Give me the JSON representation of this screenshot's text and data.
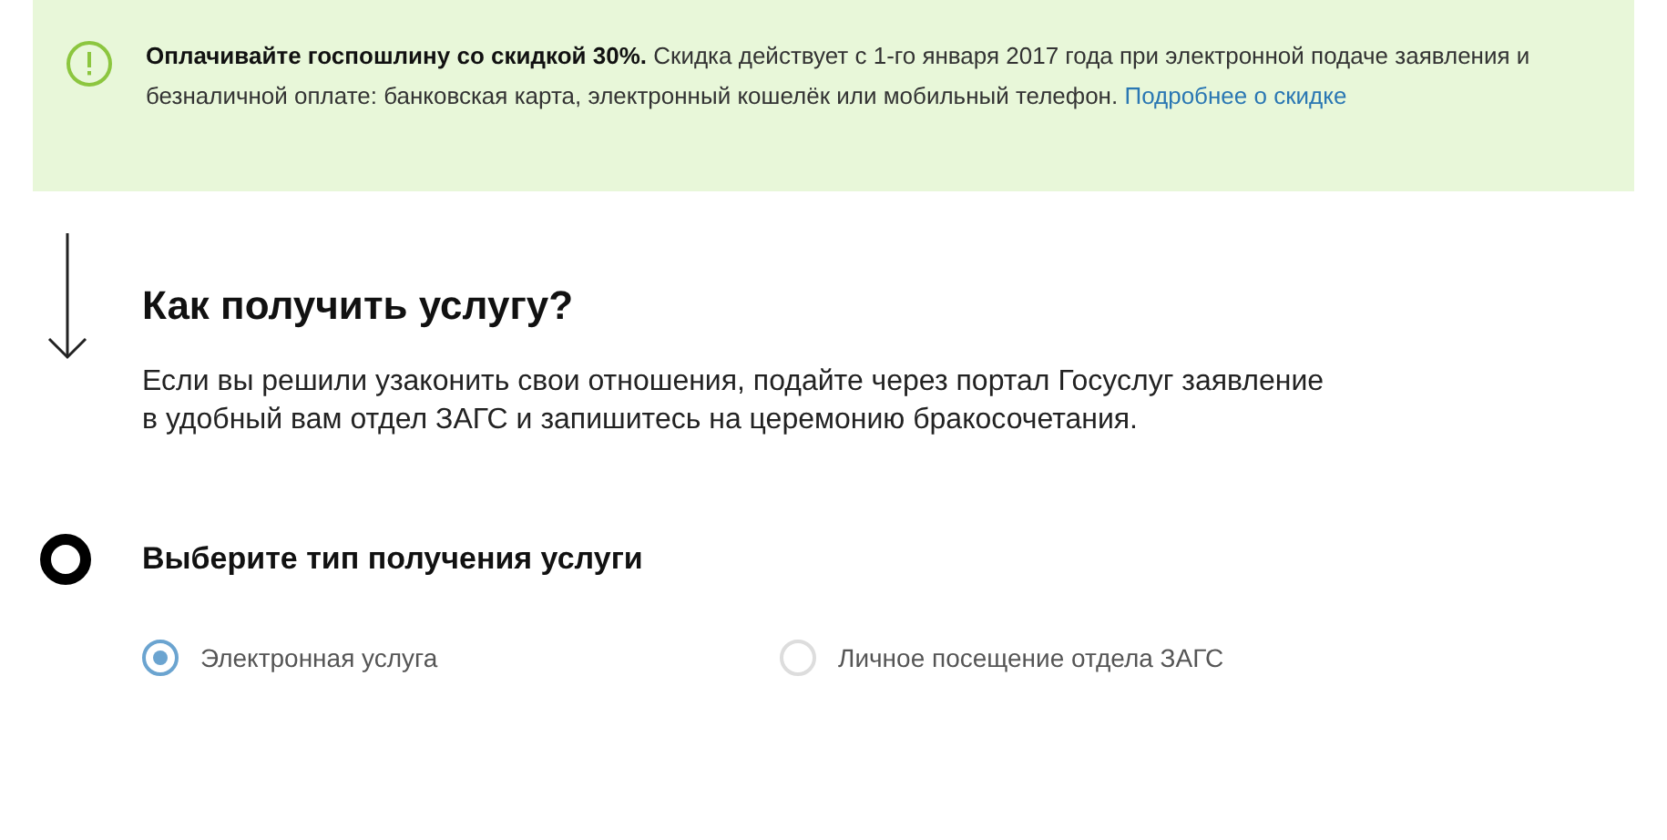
{
  "notice": {
    "text": "**Оплачивайте госпошлину со скидкой 30%.** Скидка действует с 1-го января 2017 года при электронной подаче заявления и безналичной оплате: банковская карта, электронный кошелёк или мобильный телефон.",
    "link": "Подробнее о скидке"
  },
  "section": {
    "title": "Как получить услугу?",
    "description": "Если вы решили узаконить свои отношения, подайте через портал Госуслуг заявление в удобный вам отдел ЗАГС и запишитесь на церемонию бракосочетания."
  },
  "step": {
    "title": "Выберите тип получения услуги",
    "options": [
      {
        "label": "Электронная услуга",
        "selected": true
      },
      {
        "label": "Личное посещение отдела ЗАГС",
        "selected": false
      }
    ]
  }
}
